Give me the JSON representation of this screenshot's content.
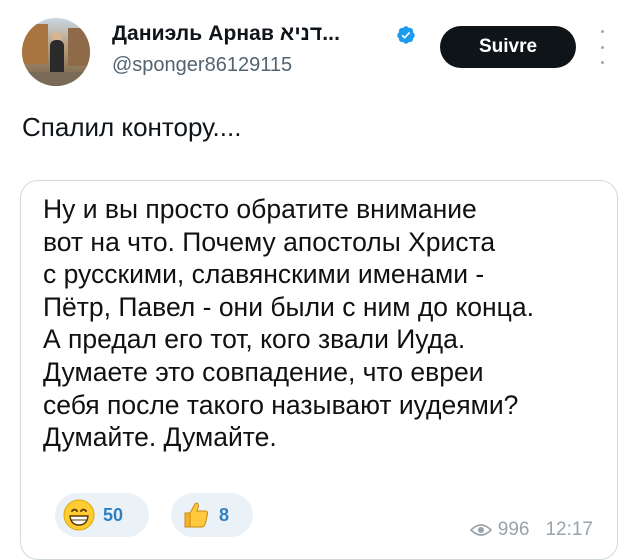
{
  "author": {
    "display_name": "Даниэль Арнав דניא...",
    "handle": "@sponger86129115",
    "verified": true,
    "avatar": "profile-photo"
  },
  "header": {
    "follow_label": "Suivre",
    "more_icon": "more-vertical-icon"
  },
  "tweet": {
    "text": "Спалил контору...."
  },
  "media": {
    "lines": [
      "Ну и вы просто обратите внимание",
      "вот на что. Почему апостолы Христа",
      "с русскими, славянскими именами -",
      "Пётр, Павел - они были с ним до конца.",
      "А предал его тот, кого звали Иуда.",
      "Думаете это совпадение, что евреи",
      "себя после такого называют иудеями?",
      "Думайте. Думайте."
    ],
    "reactions": [
      {
        "icon": "grinning-face-icon",
        "count": "50"
      },
      {
        "icon": "thumbs-up-icon",
        "count": "8"
      }
    ],
    "views": "996",
    "time": "12:17"
  },
  "colors": {
    "follow_bg": "#0f1419",
    "verified": "#1d9bf0",
    "handle": "#536471",
    "reaction_bg": "#eaf1f7",
    "reaction_count": "#2f7fc1",
    "meta": "#9aa3ab"
  }
}
